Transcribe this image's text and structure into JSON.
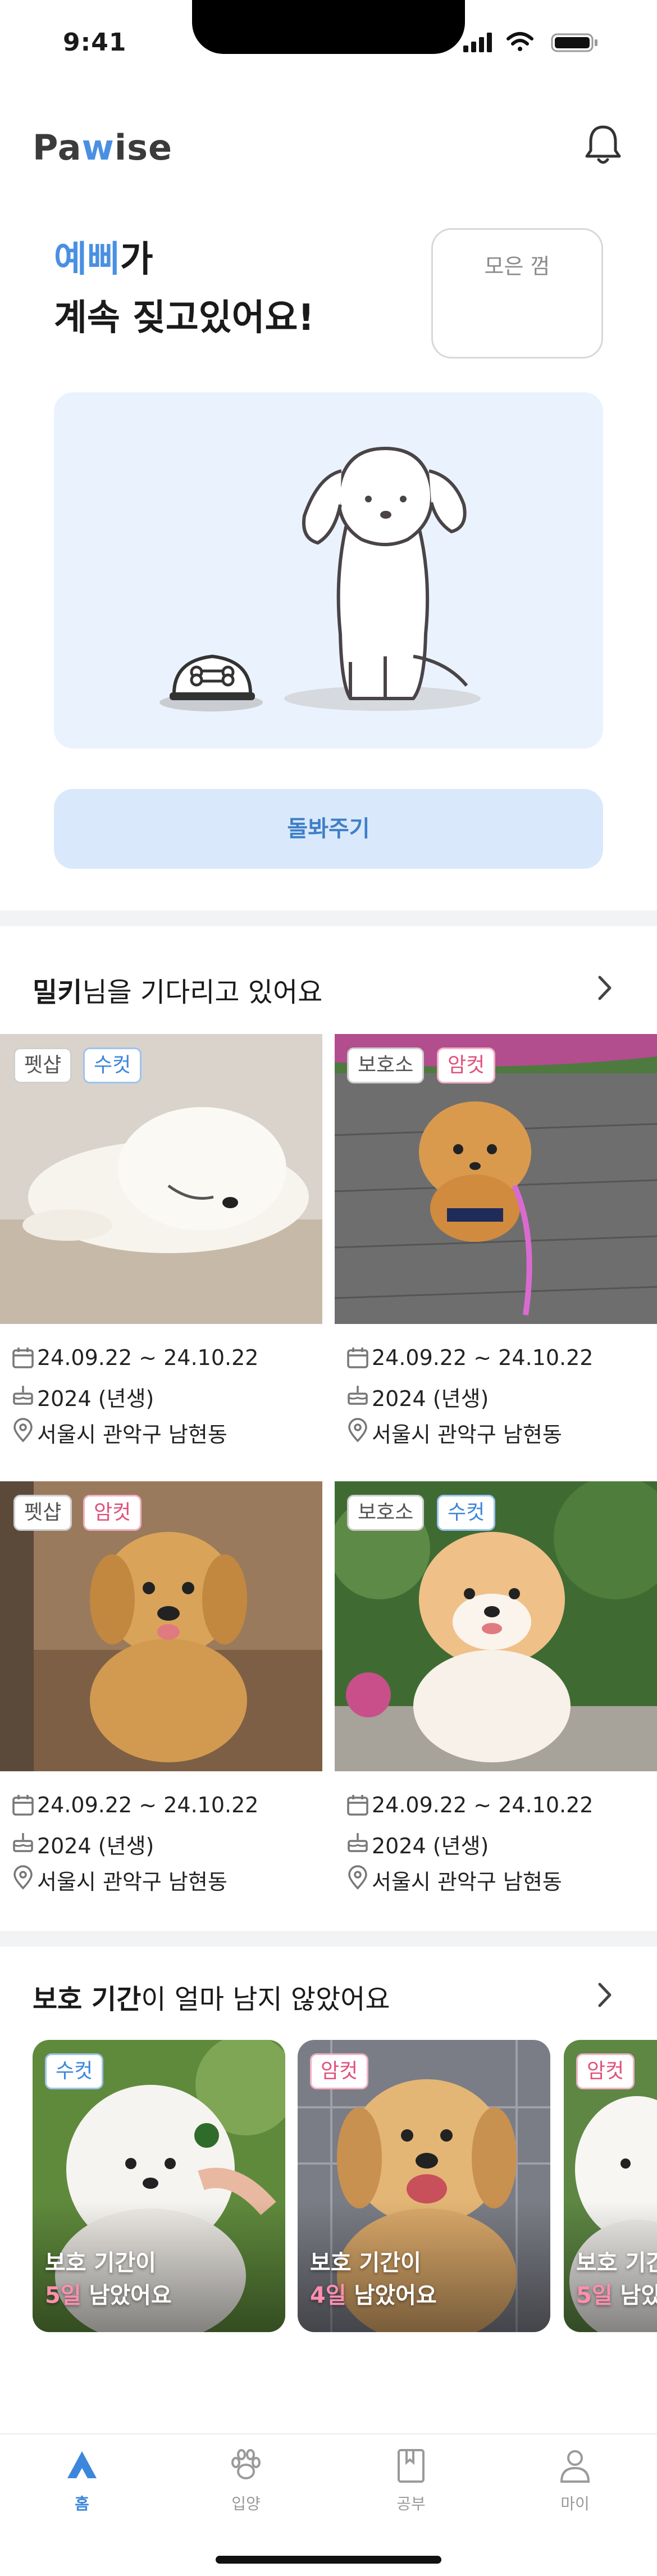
{
  "status": {
    "time": "9:41"
  },
  "header": {
    "logo_pre": "Pa",
    "logo_accent": "w",
    "logo_post": "ise"
  },
  "hero": {
    "pet_name": "예삐",
    "line1_suffix": "가",
    "line2": "계속 짖고있어요!",
    "gum_label": "모은 껌",
    "care_button": "돌봐주기"
  },
  "waiting": {
    "title_bold": "밀키",
    "title_rest": "님을 기다리고 있어요",
    "cards": [
      {
        "tags": [
          {
            "text": "펫샵",
            "style": "gray"
          },
          {
            "text": "수컷",
            "style": "blue"
          }
        ],
        "date": "24.09.22 ~ 24.10.22",
        "birth": "2024 (년생)",
        "location": "서울시 관악구 남현동"
      },
      {
        "tags": [
          {
            "text": "보호소",
            "style": "gray"
          },
          {
            "text": "암컷",
            "style": "pink"
          }
        ],
        "date": "24.09.22 ~ 24.10.22",
        "birth": "2024 (년생)",
        "location": "서울시 관악구 남현동"
      },
      {
        "tags": [
          {
            "text": "펫샵",
            "style": "gray"
          },
          {
            "text": "암컷",
            "style": "pink"
          }
        ],
        "date": "24.09.22 ~ 24.10.22",
        "birth": "2024 (년생)",
        "location": "서울시 관악구 남현동"
      },
      {
        "tags": [
          {
            "text": "보호소",
            "style": "gray"
          },
          {
            "text": "수컷",
            "style": "blue"
          }
        ],
        "date": "24.09.22 ~ 24.10.22",
        "birth": "2024 (년생)",
        "location": "서울시 관악구 남현동"
      }
    ]
  },
  "urgent": {
    "title_bold": "보호 기간",
    "title_rest": "이 얼마 남지 않았어요",
    "cards": [
      {
        "tag": {
          "text": "수컷",
          "style": "blue"
        },
        "line1": "보호 기간이",
        "days": "5일",
        "rest": " 남았어요"
      },
      {
        "tag": {
          "text": "암컷",
          "style": "pink"
        },
        "line1": "보호 기간이",
        "days": "4일",
        "rest": " 남았어요"
      },
      {
        "tag": {
          "text": "암컷",
          "style": "pink"
        },
        "line1": "보호 기간이",
        "days": "5일",
        "rest": " 남았어요"
      }
    ]
  },
  "tabs": [
    {
      "label": "홈",
      "icon": "home-icon",
      "active": true
    },
    {
      "label": "입양",
      "icon": "paw-icon",
      "active": false
    },
    {
      "label": "공부",
      "icon": "book-icon",
      "active": false
    },
    {
      "label": "마이",
      "icon": "person-icon",
      "active": false
    }
  ],
  "colors": {
    "accent": "#4a90e2",
    "pink": "#e0527d",
    "scene_bg": "#eaf3fd"
  }
}
